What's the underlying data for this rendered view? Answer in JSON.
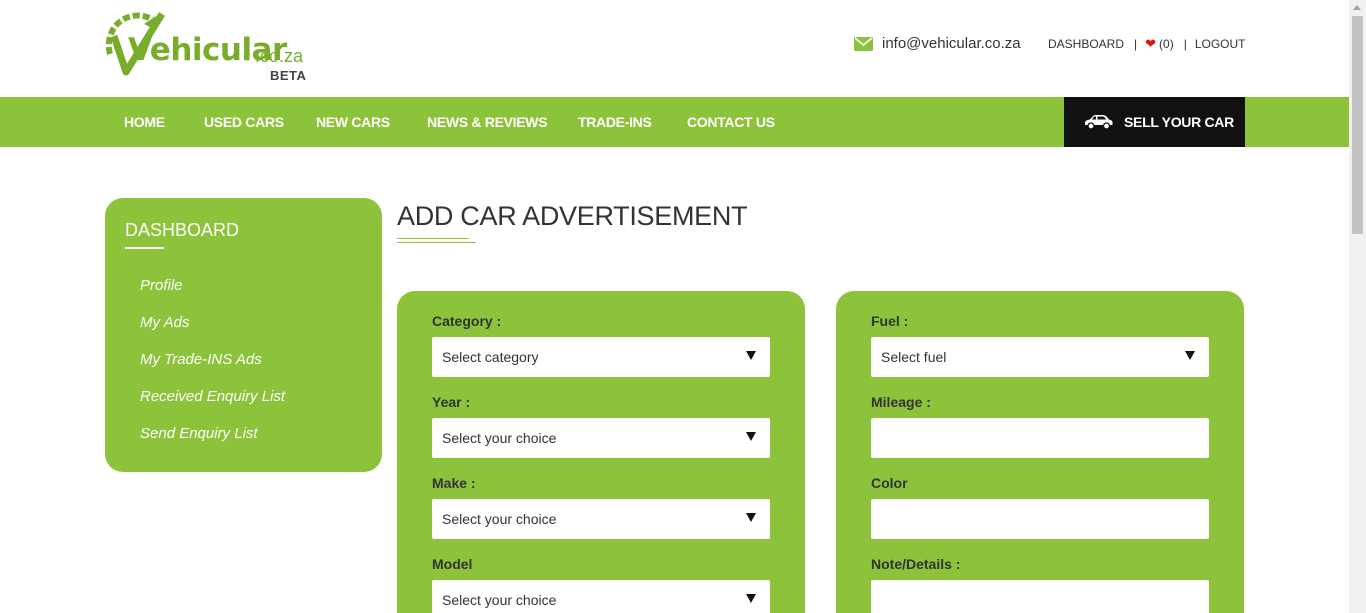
{
  "header": {
    "logo": {
      "brand": "Vehicular",
      "domain": ".co.za",
      "badge": "BETA"
    },
    "contact_email": "info@vehicular.co.za",
    "links": {
      "dashboard": "DASHBOARD",
      "favorites_count": "(0)",
      "logout": "LOGOUT"
    }
  },
  "nav": {
    "items": [
      "HOME",
      "USED CARS",
      "NEW CARS",
      "NEWS & REVIEWS",
      "TRADE-INS",
      "CONTACT US"
    ],
    "sell_button": "SELL YOUR CAR"
  },
  "sidebar": {
    "title": "DASHBOARD",
    "items": [
      "Profile",
      "My Ads",
      "My Trade-INS Ads",
      "Received Enquiry List",
      "Send Enquiry List"
    ]
  },
  "main": {
    "title": "ADD CAR ADVERTISEMENT",
    "left_fields": [
      {
        "label": "Category :",
        "value": "Select category"
      },
      {
        "label": "Year :",
        "value": "Select your choice"
      },
      {
        "label": "Make :",
        "value": "Select your choice"
      },
      {
        "label": "Model",
        "value": "Select your choice"
      }
    ],
    "right_fields": [
      {
        "label": "Fuel :",
        "value": "Select fuel"
      },
      {
        "label": "Mileage :",
        "value": ""
      },
      {
        "label": "Color",
        "value": ""
      },
      {
        "label": "Note/Details :",
        "value": ""
      }
    ]
  },
  "colors": {
    "brand_green": "#8dc33a",
    "logo_green": "#7aac2c",
    "sell_bg": "#111111",
    "heart": "#e01414"
  },
  "icons": [
    "logo-swoosh-icon",
    "envelope-icon",
    "heart-icon",
    "car-icon",
    "chevron-down-icon"
  ]
}
